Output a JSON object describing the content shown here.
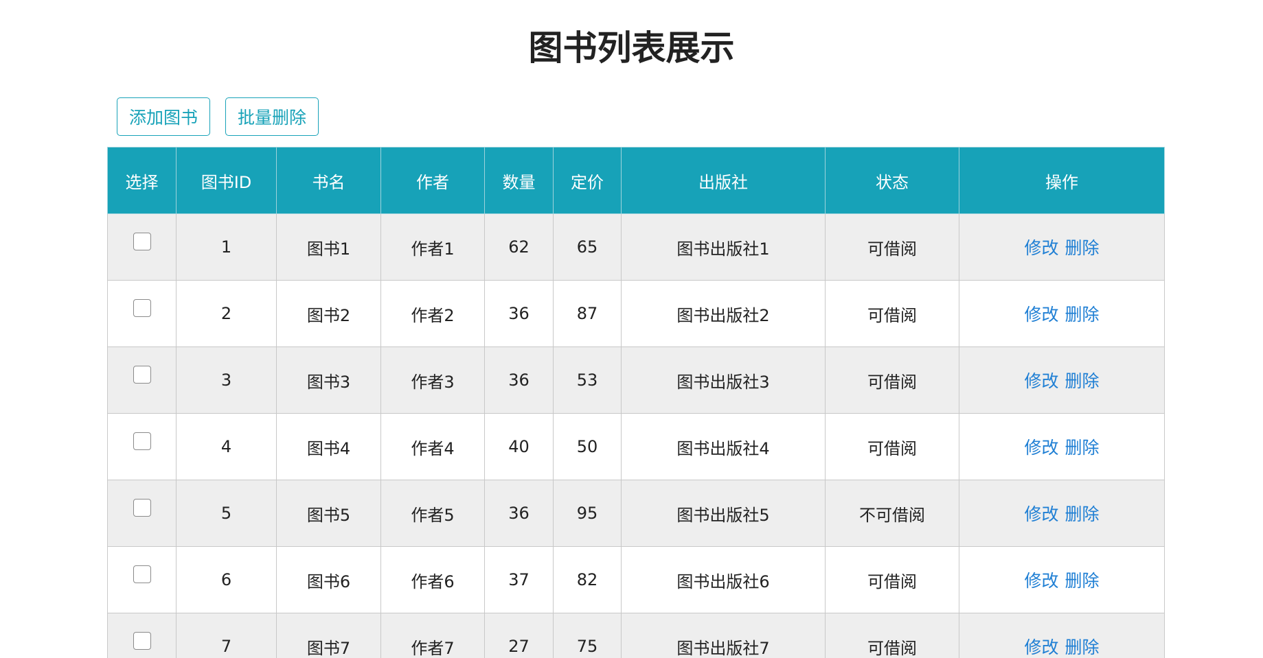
{
  "page": {
    "title": "图书列表展示"
  },
  "toolbar": {
    "add_label": "添加图书",
    "batch_delete_label": "批量删除"
  },
  "table": {
    "headers": [
      "选择",
      "图书ID",
      "书名",
      "作者",
      "数量",
      "定价",
      "出版社",
      "状态",
      "操作"
    ],
    "rows": [
      {
        "id": "1",
        "name": "图书1",
        "author": "作者1",
        "quantity": "62",
        "price": "65",
        "publisher": "图书出版社1",
        "status": "可借阅",
        "edit": "修改",
        "delete": "删除"
      },
      {
        "id": "2",
        "name": "图书2",
        "author": "作者2",
        "quantity": "36",
        "price": "87",
        "publisher": "图书出版社2",
        "status": "可借阅",
        "edit": "修改",
        "delete": "删除"
      },
      {
        "id": "3",
        "name": "图书3",
        "author": "作者3",
        "quantity": "36",
        "price": "53",
        "publisher": "图书出版社3",
        "status": "可借阅",
        "edit": "修改",
        "delete": "删除"
      },
      {
        "id": "4",
        "name": "图书4",
        "author": "作者4",
        "quantity": "40",
        "price": "50",
        "publisher": "图书出版社4",
        "status": "可借阅",
        "edit": "修改",
        "delete": "删除"
      },
      {
        "id": "5",
        "name": "图书5",
        "author": "作者5",
        "quantity": "36",
        "price": "95",
        "publisher": "图书出版社5",
        "status": "不可借阅",
        "edit": "修改",
        "delete": "删除"
      },
      {
        "id": "6",
        "name": "图书6",
        "author": "作者6",
        "quantity": "37",
        "price": "82",
        "publisher": "图书出版社6",
        "status": "可借阅",
        "edit": "修改",
        "delete": "删除"
      },
      {
        "id": "7",
        "name": "图书7",
        "author": "作者7",
        "quantity": "27",
        "price": "75",
        "publisher": "图书出版社7",
        "status": "可借阅",
        "edit": "修改",
        "delete": "删除"
      }
    ]
  },
  "colors": {
    "accent": "#17a2b8",
    "link": "#1f7fd4",
    "stripe": "#eeeeee"
  }
}
